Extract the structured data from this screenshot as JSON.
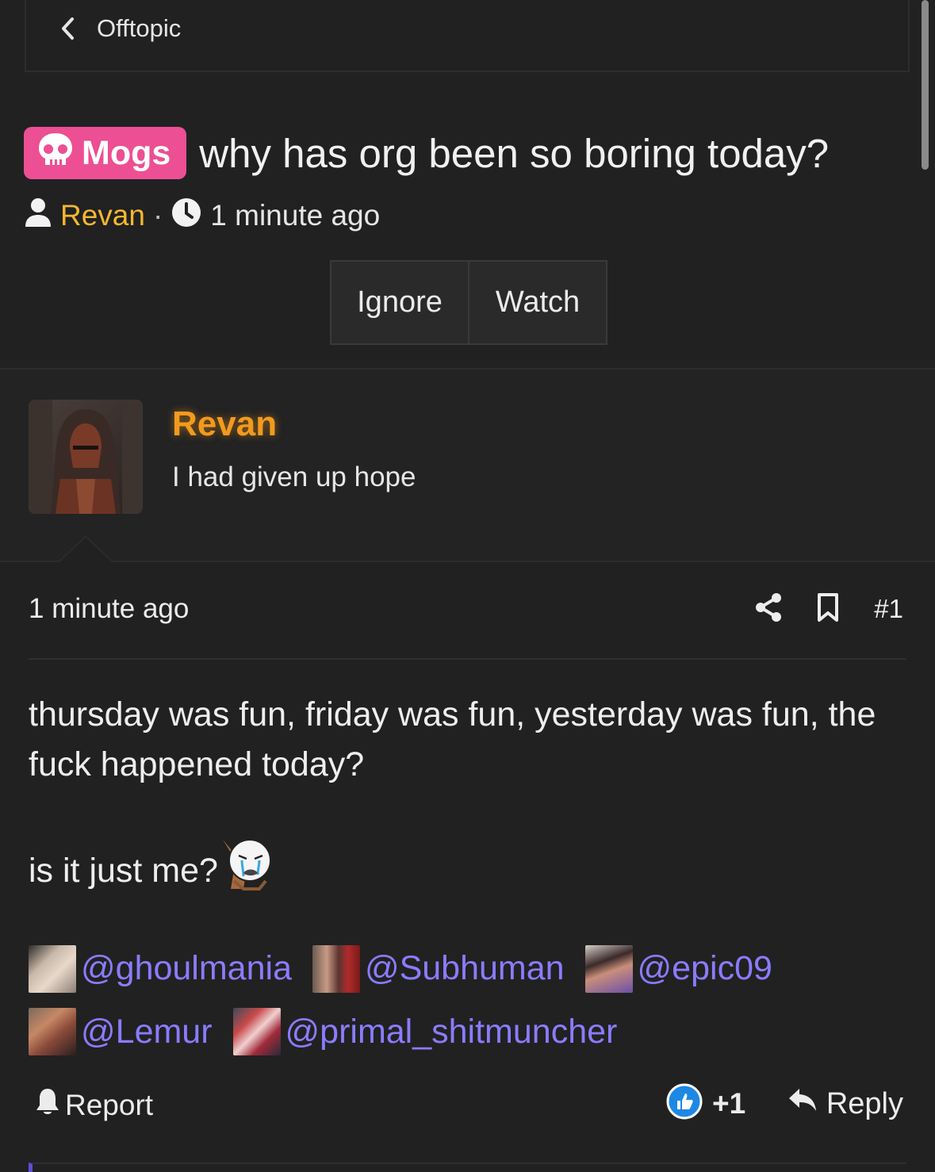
{
  "breadcrumb": {
    "label": "Offtopic"
  },
  "thread": {
    "prefix": "Mogs",
    "title": "why has org been so boring today?",
    "author": "Revan",
    "separator": "·",
    "time": "1 minute ago",
    "buttons": {
      "ignore": "Ignore",
      "watch": "Watch"
    }
  },
  "user": {
    "name": "Revan",
    "title": "I had given up hope"
  },
  "post": {
    "time": "1 minute ago",
    "number": "#1",
    "body_line1": "thursday was fun, friday was fun, yesterday was fun, the fuck happened today?",
    "body_line2": "is it just me?",
    "mentions": [
      {
        "name": "@ghoulmania"
      },
      {
        "name": "@Subhuman"
      },
      {
        "name": "@epic09"
      },
      {
        "name": "@Lemur"
      },
      {
        "name": "@primal_shitmuncher"
      }
    ],
    "report_label": "Report",
    "reaction_count": "+1",
    "reply_label": "Reply"
  },
  "colors": {
    "prefix_bg": "#ec4f93",
    "author": "#f5b731",
    "username_glow": "#f39a1d",
    "mention": "#8a7cff",
    "background": "#212121"
  },
  "icons": [
    "chevron-left-icon",
    "skull-icon",
    "user-icon",
    "clock-icon",
    "share-icon",
    "bookmark-icon",
    "bell-icon",
    "like-icon",
    "reply-icon",
    "crying-face-icon"
  ]
}
